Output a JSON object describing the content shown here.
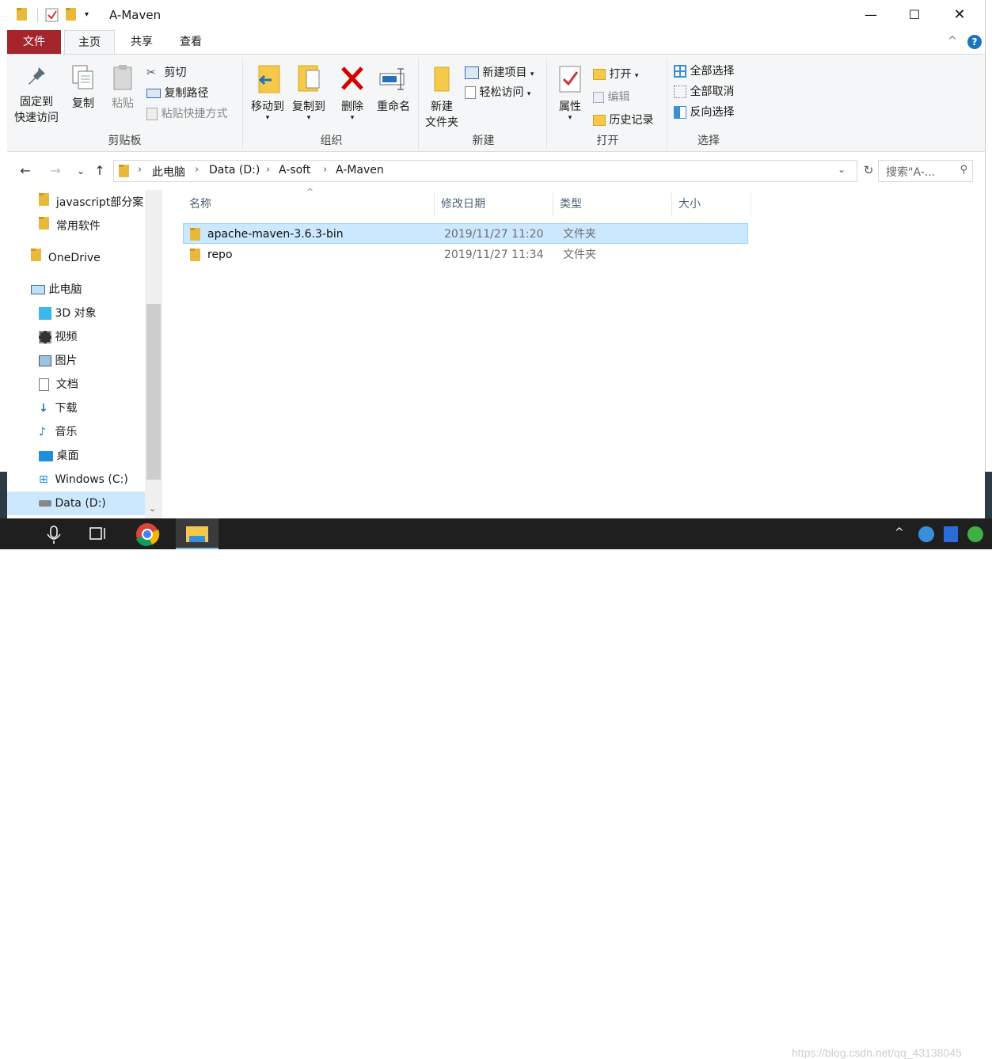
{
  "window": {
    "title": "A-Maven"
  },
  "tabs": [
    {
      "label": "文件"
    },
    {
      "label": "主页"
    },
    {
      "label": "共享"
    },
    {
      "label": "查看"
    }
  ],
  "ribbon": {
    "clipboard": {
      "label": "剪贴板",
      "pin": "固定到",
      "pin2": "快速访问",
      "copy": "复制",
      "paste": "粘贴",
      "cut": "剪切",
      "copy_path": "复制路径",
      "paste_shortcut": "粘贴快捷方式"
    },
    "organize": {
      "label": "组织",
      "move_to": "移动到",
      "copy_to": "复制到",
      "delete": "删除",
      "rename": "重命名"
    },
    "new": {
      "label": "新建",
      "new_folder": "新建",
      "new_folder2": "文件夹",
      "new_item": "新建项目",
      "easy_access": "轻松访问"
    },
    "open": {
      "label": "打开",
      "properties": "属性",
      "open": "打开",
      "edit": "编辑",
      "history": "历史记录"
    },
    "select": {
      "label": "选择",
      "select_all": "全部选择",
      "select_none": "全部取消",
      "invert": "反向选择"
    }
  },
  "address": {
    "crumbs": [
      "此电脑",
      "Data (D:)",
      "A-soft",
      "A-Maven"
    ],
    "search_placeholder": "搜索\"A-..."
  },
  "sidebar": [
    {
      "label": "javascript部分案",
      "icon": "folder-icon"
    },
    {
      "label": "常用软件",
      "icon": "folder-icon"
    },
    {
      "label": "OneDrive",
      "icon": "folder-icon"
    },
    {
      "label": "此电脑",
      "icon": "computer-icon"
    },
    {
      "label": "3D 对象",
      "icon": "3d-objects-icon"
    },
    {
      "label": "视频",
      "icon": "video-icon"
    },
    {
      "label": "图片",
      "icon": "pictures-icon"
    },
    {
      "label": "文档",
      "icon": "documents-icon"
    },
    {
      "label": "下载",
      "icon": "download-icon"
    },
    {
      "label": "音乐",
      "icon": "music-icon"
    },
    {
      "label": "桌面",
      "icon": "desktop-icon"
    },
    {
      "label": "Windows (C:)",
      "icon": "drive-icon"
    },
    {
      "label": "Data (D:)",
      "icon": "drive-icon"
    }
  ],
  "columns": {
    "name": "名称",
    "date": "修改日期",
    "type": "类型",
    "size": "大小"
  },
  "files": [
    {
      "name": "apache-maven-3.6.3-bin",
      "date": "2019/11/27 11:20",
      "type": "文件夹",
      "size": ""
    },
    {
      "name": "repo",
      "date": "2019/11/27 11:34",
      "type": "文件夹",
      "size": ""
    }
  ],
  "watermark": "https://blog.csdn.net/qq_43138045"
}
